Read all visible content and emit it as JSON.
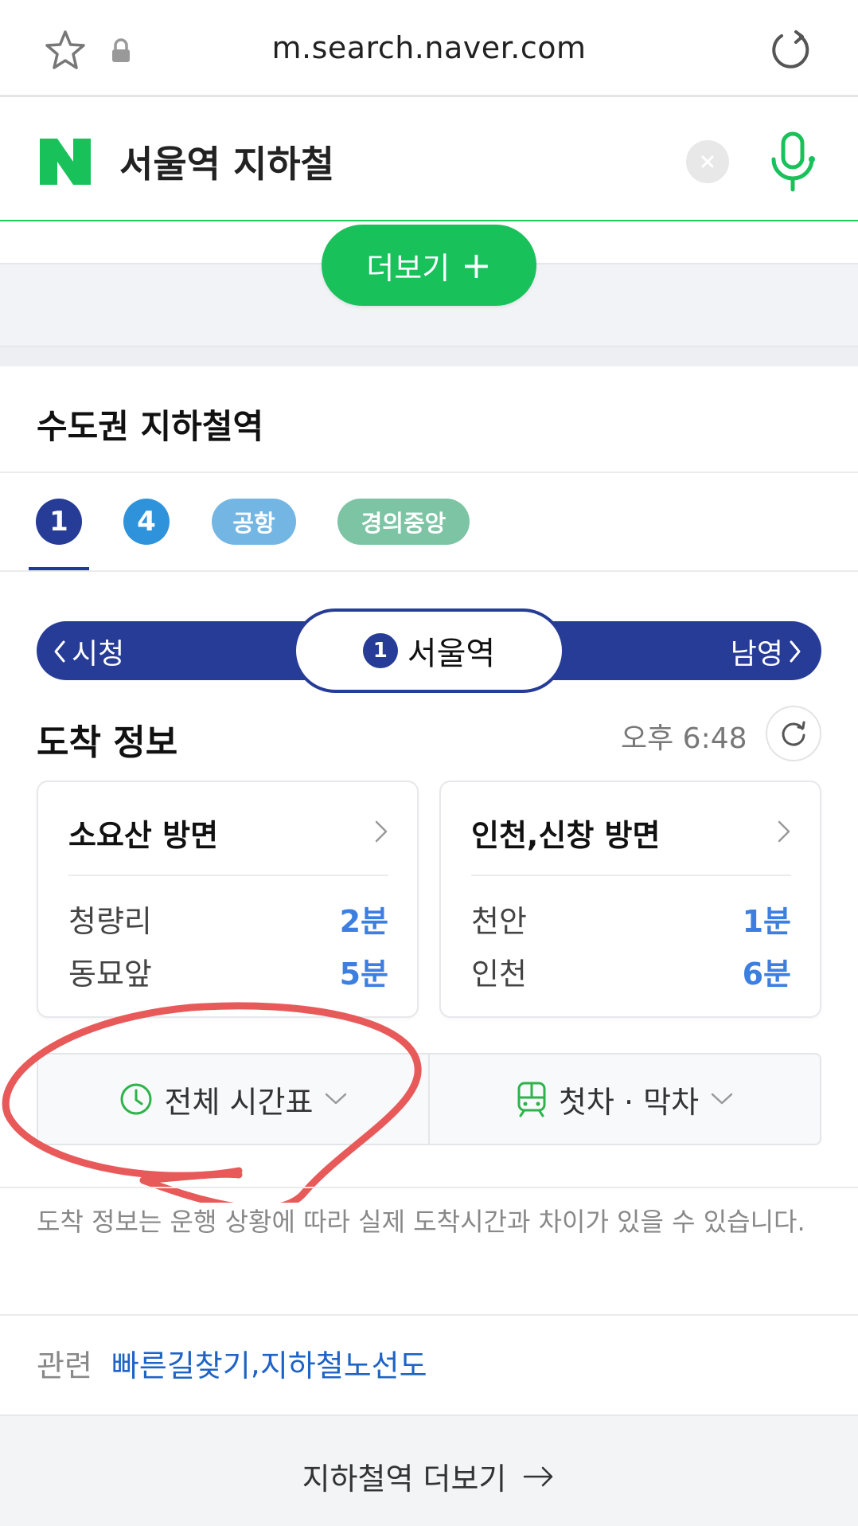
{
  "browser": {
    "url": "m.search.naver.com"
  },
  "search": {
    "logo_text": "N",
    "query": "서울역 지하철",
    "clear_icon": "close-icon",
    "mic_icon": "microphone-icon"
  },
  "more_button": {
    "label": "더보기",
    "plus": "+"
  },
  "section": {
    "title": "수도권 지하철역"
  },
  "line_tabs": [
    {
      "label": "1",
      "color": "#263c97",
      "selected": true
    },
    {
      "label": "4",
      "color": "#2f93dc",
      "selected": false
    },
    {
      "label": "공항",
      "color": "#73b6e4",
      "selected": false
    },
    {
      "label": "경의중앙",
      "color": "#7cc4a4",
      "selected": false
    }
  ],
  "station_bar": {
    "prev_station": "시청",
    "current_line": "1",
    "current_station": "서울역",
    "next_station": "남영",
    "color": "#263c97"
  },
  "arrival": {
    "title": "도착 정보",
    "time": "오후 6:48",
    "cards": [
      {
        "direction": "소요산 방면",
        "rows": [
          {
            "dest": "청량리",
            "mins": "2분"
          },
          {
            "dest": "동묘앞",
            "mins": "5분"
          }
        ]
      },
      {
        "direction": "인천,신창 방면",
        "rows": [
          {
            "dest": "천안",
            "mins": "1분"
          },
          {
            "dest": "인천",
            "mins": "6분"
          }
        ]
      }
    ]
  },
  "timetable": {
    "full_label": "전체 시간표",
    "first_last_label": "첫차 · 막차"
  },
  "notice": "도착 정보는 운행 상황에 따라 실제 도착시간과 차이가 있을 수 있습니다.",
  "related": {
    "label": "관련",
    "links": [
      "빠른길찾기",
      "지하철노선도"
    ],
    "separator": ","
  },
  "footer": {
    "label": "지하철역 더보기",
    "arrow": "→"
  },
  "colors": {
    "naver_green": "#19c15b",
    "line1_blue": "#263c97",
    "minutes_blue": "#3d7fe0",
    "annotation_red": "#e85a5a"
  }
}
